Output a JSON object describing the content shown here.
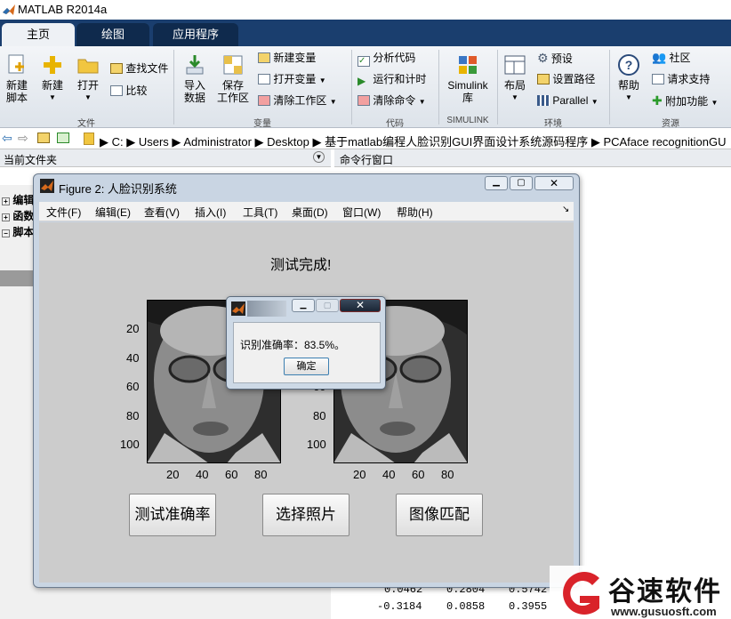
{
  "app": {
    "title": "MATLAB R2014a"
  },
  "tabs": [
    {
      "label": "主页"
    },
    {
      "label": "绘图"
    },
    {
      "label": "应用程序"
    }
  ],
  "ribbon": {
    "file": {
      "new_script": [
        "新建",
        "脚本"
      ],
      "new": "新建",
      "open": "打开",
      "find_files": "查找文件",
      "compare": "比较",
      "section": "文件"
    },
    "variable": {
      "import": [
        "导入",
        "数据"
      ],
      "save": [
        "保存",
        "工作区"
      ],
      "new_var": "新建变量",
      "open_var": "打开变量",
      "clear_ws": "清除工作区",
      "section": "变量"
    },
    "code": {
      "analyze": "分析代码",
      "run_time": "运行和计时",
      "clear_cmd": "清除命令",
      "section": "代码"
    },
    "simulink": {
      "lib": [
        "Simulink",
        "库"
      ],
      "section": "SIMULINK"
    },
    "env": {
      "layout": "布局",
      "prefs": "预设",
      "set_path": "设置路径",
      "parallel": "Parallel",
      "section": "环境"
    },
    "resources": {
      "help": "帮助",
      "community": "社区",
      "request_support": "请求支持",
      "addons": "附加功能",
      "section": "资源"
    }
  },
  "address": {
    "segments": [
      "C:",
      "Users",
      "Administrator",
      "Desktop",
      "基于matlab编程人脸识别GUI界面设计系统源码程序",
      "PCAface recognitionGU"
    ]
  },
  "panels": {
    "current_folder": "当前文件夹",
    "command_window": "命令行窗口",
    "tree": [
      "编辑",
      "函数",
      "脚本"
    ]
  },
  "command_output": {
    "row1": [
      "0.0462",
      "0.2804",
      "0.5742"
    ],
    "row2": [
      "-0.3184",
      "0.0858",
      "0.3955"
    ]
  },
  "figure": {
    "title": "Figure 2: 人脸识别系统",
    "menu": [
      "文件(F)",
      "编辑(E)",
      "查看(V)",
      "插入(I)",
      "工具(T)",
      "桌面(D)",
      "窗口(W)",
      "帮助(H)"
    ],
    "status_text": "测试完成!",
    "yticks": [
      "20",
      "40",
      "60",
      "80",
      "100"
    ],
    "xticks": [
      "20",
      "40",
      "60",
      "80"
    ],
    "buttons": {
      "test_accuracy": "测试准确率",
      "select_photo": "选择照片",
      "image_match": "图像匹配"
    }
  },
  "dialog": {
    "message": "识别准确率：83.5%。",
    "ok": "确定"
  },
  "watermark": {
    "name": "谷速软件",
    "url": "www.gusuosft.com"
  },
  "colors": {
    "tab_bar": "#1a3e6e",
    "watermark_red": "#d9232a",
    "figure_bg": "#cccccc"
  }
}
